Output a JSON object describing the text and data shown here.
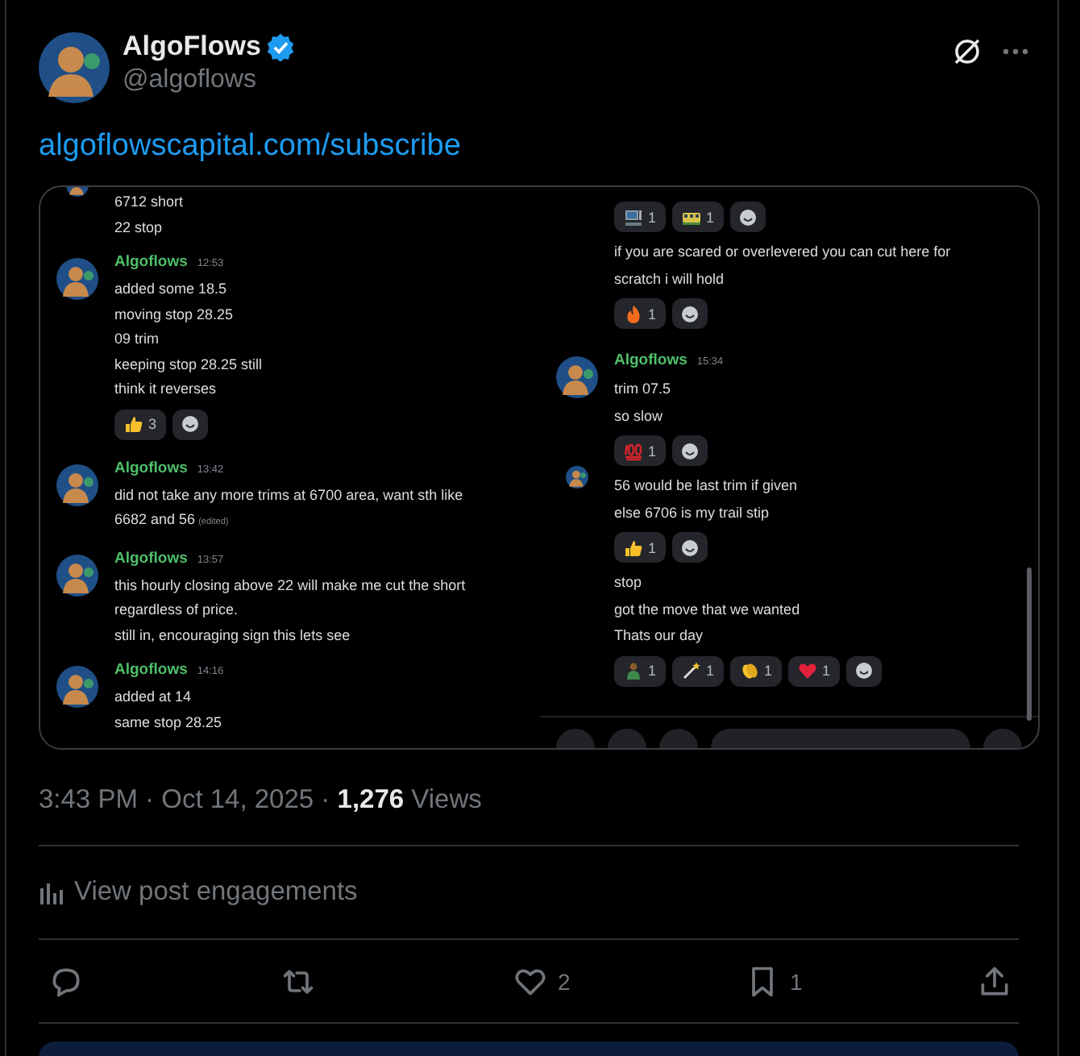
{
  "post": {
    "author": {
      "name": "AlgoFlows",
      "verified": true,
      "handle": "@algoflows"
    },
    "link": "algoflowscapital.com/subscribe",
    "screenshot": {
      "left_panel": [
        {
          "kind": "cut-avatar",
          "lines": [
            "6712 short",
            "22 stop"
          ]
        },
        {
          "kind": "group",
          "author": "Algoflows",
          "time": "12:53",
          "lines": [
            "added some 18.5",
            "moving stop 28.25",
            "09 trim",
            "keeping stop 28.25 still",
            "think it reverses"
          ],
          "reactions": [
            {
              "kind": "thumbs-up",
              "count": "3"
            }
          ]
        },
        {
          "kind": "group",
          "author": "Algoflows",
          "time": "13:42",
          "lines": [
            "did not take any more trims at 6700 area, want sth like 6682 and 56"
          ],
          "edited": "(edited)"
        },
        {
          "kind": "group",
          "author": "Algoflows",
          "time": "13:57",
          "lines": [
            "this hourly closing above 22 will make me cut the short regardless of price.",
            "still in, encouraging sign this lets see"
          ]
        },
        {
          "kind": "group",
          "author": "Algoflows",
          "time": "14:16",
          "lines": [
            "added at 14",
            "same stop 28.25"
          ]
        }
      ],
      "right_panel": [
        {
          "kind": "plain",
          "reactions": [
            {
              "kind": "computer",
              "count": "1"
            },
            {
              "kind": "train",
              "count": "1"
            }
          ]
        },
        {
          "kind": "plain",
          "lines": [
            "if you are scared or overlevered you can cut here for scratch i will hold"
          ],
          "reactions": [
            {
              "kind": "fire",
              "count": "1"
            }
          ]
        },
        {
          "kind": "group",
          "author": "Algoflows",
          "time": "15:34",
          "lines": [
            "trim 07.5",
            "so slow"
          ],
          "reactions": [
            {
              "kind": "hundred",
              "count": "1"
            }
          ]
        },
        {
          "kind": "cut-avatar",
          "lines": [
            "56 would be last trim if given",
            "else 6706 is my trail stip"
          ],
          "reactions": [
            {
              "kind": "thumbs-up",
              "count": "1"
            }
          ]
        },
        {
          "kind": "plain",
          "lines": [
            "stop",
            "got the move that we wanted",
            "Thats our day"
          ],
          "reactions": [
            {
              "kind": "person",
              "count": "1"
            },
            {
              "kind": "wand",
              "count": "1"
            },
            {
              "kind": "clap",
              "count": "1"
            },
            {
              "kind": "heart",
              "count": "1"
            }
          ]
        }
      ]
    },
    "meta": "3:43 PM · Oct 14, 2025 · **1,276** Views",
    "engagements": "View post engagements",
    "actions": [
      {
        "kind": "reply"
      },
      {
        "kind": "repost"
      },
      {
        "kind": "like",
        "count": "2"
      },
      {
        "kind": "bookmark",
        "count": "1"
      },
      {
        "kind": "share"
      }
    ]
  }
}
